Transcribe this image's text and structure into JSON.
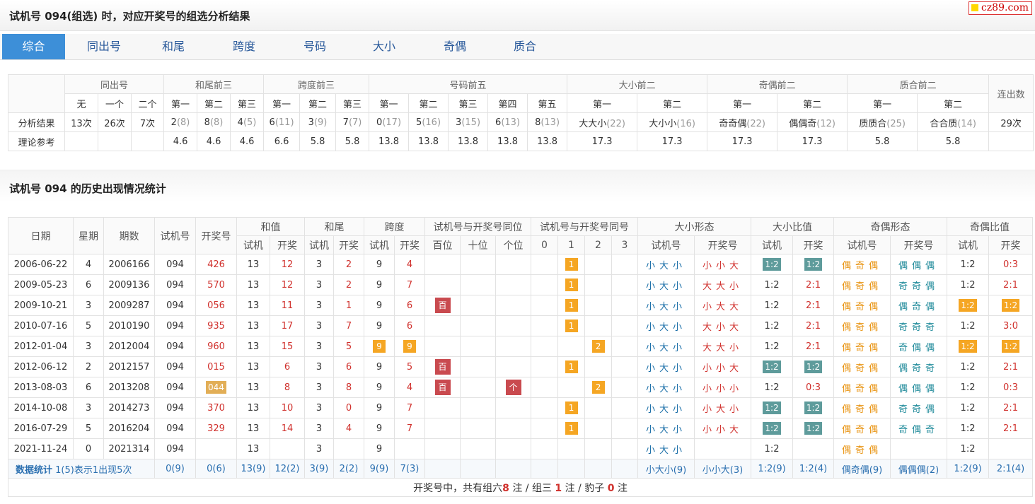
{
  "page": {
    "title": "试机号 094(组选) 时，对应开奖号的组选分析结果",
    "logo": "cz89.com",
    "section2_title": "试机号 094 的历史出现情况统计"
  },
  "tabs": [
    "综合",
    "同出号",
    "和尾",
    "跨度",
    "号码",
    "大小",
    "奇偶",
    "质合"
  ],
  "analysis": {
    "groups": [
      "同出号",
      "和尾前三",
      "跨度前三",
      "号码前五",
      "大小前二",
      "奇偶前二",
      "质合前二",
      "连出数"
    ],
    "subs": [
      "无",
      "一个",
      "二个",
      "第一",
      "第二",
      "第三",
      "第一",
      "第二",
      "第三",
      "第一",
      "第二",
      "第三",
      "第四",
      "第五",
      "第一",
      "第二",
      "第一",
      "第二",
      "第一",
      "第二"
    ],
    "row_labels": [
      "分析结果",
      "理论参考"
    ],
    "result": [
      {
        "v": "13次"
      },
      {
        "v": "26次"
      },
      {
        "v": "7次"
      },
      {
        "v": "2",
        "c": "(8)"
      },
      {
        "v": "8",
        "c": "(8)"
      },
      {
        "v": "4",
        "c": "(5)"
      },
      {
        "v": "6",
        "c": "(11)"
      },
      {
        "v": "3",
        "c": "(9)"
      },
      {
        "v": "7",
        "c": "(7)"
      },
      {
        "v": "0",
        "c": "(17)"
      },
      {
        "v": "5",
        "c": "(16)"
      },
      {
        "v": "3",
        "c": "(15)"
      },
      {
        "v": "6",
        "c": "(13)"
      },
      {
        "v": "8",
        "c": "(13)"
      },
      {
        "v": "大大小",
        "c": "(22)"
      },
      {
        "v": "大小小",
        "c": "(16)"
      },
      {
        "v": "奇奇偶",
        "c": "(22)"
      },
      {
        "v": "偶偶奇",
        "c": "(12)"
      },
      {
        "v": "质质合",
        "c": "(25)"
      },
      {
        "v": "合合质",
        "c": "(14)"
      },
      {
        "v": "29次"
      }
    ],
    "theory": [
      "",
      "",
      "",
      "4.6",
      "4.6",
      "4.6",
      "6.6",
      "5.8",
      "5.8",
      "13.8",
      "13.8",
      "13.8",
      "13.8",
      "13.8",
      "17.3",
      "17.3",
      "17.3",
      "17.3",
      "5.8",
      "5.8",
      ""
    ]
  },
  "history": {
    "headers": {
      "date": "日期",
      "week": "星期",
      "issue": "期数",
      "test": "试机号",
      "draw": "开奖号",
      "sum": "和值",
      "tail": "和尾",
      "span": "跨度",
      "samepos": "试机号与开奖号同位",
      "samenum": "试机号与开奖号同号",
      "bsform": "大小形态",
      "bsratio": "大小比值",
      "oeform": "奇偶形态",
      "oeratio": "奇偶比值"
    },
    "subheaders": {
      "test": "试机",
      "draw": "开奖",
      "bai": "百位",
      "shi": "十位",
      "ge": "个位",
      "n0": "0",
      "n1": "1",
      "n2": "2",
      "n3": "3",
      "testno": "试机号",
      "drawno": "开奖号"
    },
    "rows": [
      {
        "date": "2006-06-22",
        "week": "4",
        "issue": "2006166",
        "test": "094",
        "draw": "426",
        "s1": "13",
        "s2": "12",
        "t1": "3",
        "t2": "2",
        "k1": "9",
        "k2": "4",
        "same": "1",
        "sameIdx": 1,
        "bs1": "小大小",
        "bs2": "小小大",
        "bsr1": "1:2",
        "bsr2": "1:2",
        "oe1": "偶奇偶",
        "oe2": "偶偶偶",
        "oer1": "1:2",
        "oer2": "0:3"
      },
      {
        "date": "2009-05-23",
        "week": "6",
        "issue": "2009136",
        "test": "094",
        "draw": "570",
        "s1": "13",
        "s2": "12",
        "t1": "3",
        "t2": "2",
        "k1": "9",
        "k2": "7",
        "same": "1",
        "sameIdx": 1,
        "bs1": "小大小",
        "bs2": "大大小",
        "bsr1": "1:2",
        "bsr2": "2:1",
        "oe1": "偶奇偶",
        "oe2": "奇奇偶",
        "oer1": "1:2",
        "oer2": "2:1"
      },
      {
        "date": "2009-10-21",
        "week": "3",
        "issue": "2009287",
        "test": "094",
        "draw": "056",
        "s1": "13",
        "s2": "11",
        "t1": "3",
        "t2": "1",
        "k1": "9",
        "k2": "6",
        "bai": "百",
        "same": "1",
        "sameIdx": 1,
        "bs1": "小大小",
        "bs2": "小大大",
        "bsr1": "1:2",
        "bsr2": "2:1",
        "oe1": "偶奇偶",
        "oe2": "偶奇偶",
        "oer1": "1:2",
        "oer2": "1:2"
      },
      {
        "date": "2010-07-16",
        "week": "5",
        "issue": "2010190",
        "test": "094",
        "draw": "935",
        "s1": "13",
        "s2": "17",
        "t1": "3",
        "t2": "7",
        "k1": "9",
        "k2": "6",
        "same": "1",
        "sameIdx": 1,
        "bs1": "小大小",
        "bs2": "大小大",
        "bsr1": "1:2",
        "bsr2": "2:1",
        "oe1": "偶奇偶",
        "oe2": "奇奇奇",
        "oer1": "1:2",
        "oer2": "3:0"
      },
      {
        "date": "2012-01-04",
        "week": "3",
        "issue": "2012004",
        "test": "094",
        "draw": "960",
        "s1": "13",
        "s2": "15",
        "t1": "3",
        "t2": "5",
        "k1": "9",
        "k2": "9",
        "same": "2",
        "sameIdx": 2,
        "bs1": "小大小",
        "bs2": "大大小",
        "bsr1": "1:2",
        "bsr2": "2:1",
        "oe1": "偶奇偶",
        "oe2": "奇偶偶",
        "oer1": "1:2",
        "oer2": "1:2"
      },
      {
        "date": "2012-06-12",
        "week": "2",
        "issue": "2012157",
        "test": "094",
        "draw": "015",
        "s1": "13",
        "s2": "6",
        "t1": "3",
        "t2": "6",
        "k1": "9",
        "k2": "5",
        "bai": "百",
        "same": "1",
        "sameIdx": 1,
        "bs1": "小大小",
        "bs2": "小小大",
        "bsr1": "1:2",
        "bsr2": "1:2",
        "oe1": "偶奇偶",
        "oe2": "偶奇奇",
        "oer1": "1:2",
        "oer2": "2:1"
      },
      {
        "date": "2013-08-03",
        "week": "6",
        "issue": "2013208",
        "test": "094",
        "draw": "044",
        "s1": "13",
        "s2": "8",
        "t1": "3",
        "t2": "8",
        "k1": "9",
        "k2": "4",
        "bai": "百",
        "ge": "个",
        "same": "2",
        "sameIdx": 2,
        "bs1": "小大小",
        "bs2": "小小小",
        "bsr1": "1:2",
        "bsr2": "0:3",
        "oe1": "偶奇偶",
        "oe2": "偶偶偶",
        "oer1": "1:2",
        "oer2": "0:3"
      },
      {
        "date": "2014-10-08",
        "week": "3",
        "issue": "2014273",
        "test": "094",
        "draw": "370",
        "s1": "13",
        "s2": "10",
        "t1": "3",
        "t2": "0",
        "k1": "9",
        "k2": "7",
        "same": "1",
        "sameIdx": 1,
        "bs1": "小大小",
        "bs2": "小大小",
        "bsr1": "1:2",
        "bsr2": "1:2",
        "oe1": "偶奇偶",
        "oe2": "奇奇偶",
        "oer1": "1:2",
        "oer2": "2:1"
      },
      {
        "date": "2016-07-29",
        "week": "5",
        "issue": "2016204",
        "test": "094",
        "draw": "329",
        "s1": "13",
        "s2": "14",
        "t1": "3",
        "t2": "4",
        "k1": "9",
        "k2": "7",
        "same": "1",
        "sameIdx": 1,
        "bs1": "小大小",
        "bs2": "小小大",
        "bsr1": "1:2",
        "bsr2": "1:2",
        "oe1": "偶奇偶",
        "oe2": "奇偶奇",
        "oer1": "1:2",
        "oer2": "2:1"
      },
      {
        "date": "2021-11-24",
        "week": "0",
        "issue": "2021314",
        "test": "094",
        "draw": "",
        "s1": "13",
        "s2": "",
        "t1": "3",
        "t2": "",
        "k1": "9",
        "k2": "",
        "bs1": "小大小",
        "bs2": "",
        "bsr1": "1:2",
        "bsr2": "",
        "oe1": "偶奇偶",
        "oe2": "",
        "oer1": "1:2",
        "oer2": ""
      }
    ],
    "stats": {
      "label": "数据统计",
      "note": "1(5)表示1出现5次",
      "test": "0(9)",
      "draw": "0(6)",
      "s1": "13(9)",
      "s2": "12(2)",
      "t1": "3(9)",
      "t2": "2(2)",
      "k1": "9(9)",
      "k2": "7(3)",
      "bs1": "小大小(9)",
      "bs2": "小小大(3)",
      "bsr1": "1:2(9)",
      "bsr2": "1:2(4)",
      "oe1": "偶奇偶(9)",
      "oe2": "偶偶偶(2)",
      "oer1": "1:2(9)",
      "oer2": "2:1(4)"
    },
    "footer": {
      "p1": "开奖号中，共有组六",
      "n1": "8",
      "p2": " 注 / 组三 ",
      "n2": "1",
      "p3": " 注 / 豹子 ",
      "n3": "0",
      "p4": " 注"
    }
  }
}
